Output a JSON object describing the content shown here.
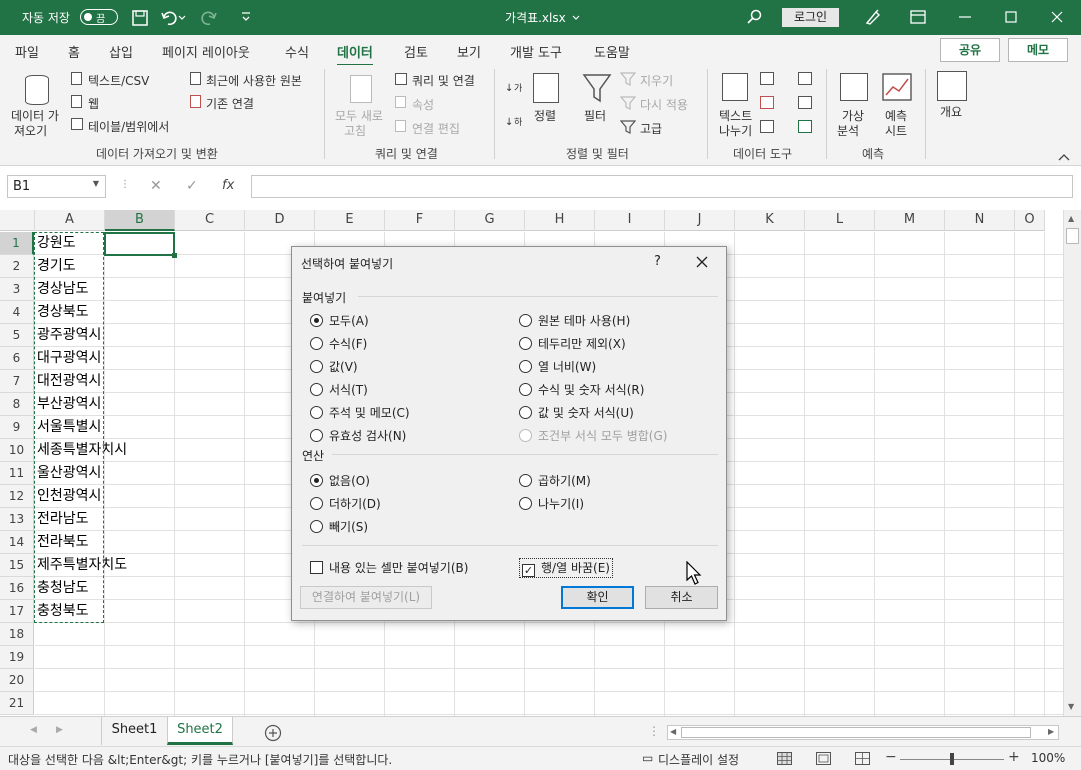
{
  "titlebar": {
    "autosave_label": "자동 저장",
    "autosave_state": "끔",
    "filename": "가격표.xlsx",
    "login": "로그인"
  },
  "menu": {
    "tabs": [
      "파일",
      "홈",
      "삽입",
      "페이지 레이아웃",
      "수식",
      "데이터",
      "검토",
      "보기",
      "개발 도구",
      "도움말"
    ],
    "active": "데이터",
    "share": "공유",
    "memo": "메모"
  },
  "ribbon": {
    "get_data_line1": "데이터 가",
    "get_data_line2": "져오기",
    "text_csv": "텍스트/CSV",
    "web": "웹",
    "table_range": "테이블/범위에서",
    "recent_sources": "최근에 사용한 원본",
    "existing_conn": "기존 연결",
    "refresh_line1": "모두 새로",
    "refresh_line2": "고침",
    "queries_conn": "쿼리 및 연결",
    "properties": "속성",
    "edit_links": "연결 편집",
    "sort": "정렬",
    "filter": "필터",
    "clear": "지우기",
    "reapply": "다시 적용",
    "advanced": "고급",
    "text_to_col_line1": "텍스트",
    "text_to_col_line2": "나누기",
    "whatif_line1": "가상",
    "whatif_line2": "분석",
    "forecast_line1": "예측",
    "forecast_line2": "시트",
    "outline": "개요",
    "group_get": "데이터 가져오기 및 변환",
    "group_queries": "쿼리 및 연결",
    "group_sort": "정렬 및 필터",
    "group_tools": "데이터 도구",
    "group_forecast": "예측"
  },
  "formula": {
    "namebox": "B1",
    "value": ""
  },
  "columns": [
    "A",
    "B",
    "C",
    "D",
    "E",
    "F",
    "G",
    "H",
    "I",
    "J",
    "K",
    "L",
    "M",
    "N",
    "O"
  ],
  "rows": [
    "1",
    "2",
    "3",
    "4",
    "5",
    "6",
    "7",
    "8",
    "9",
    "10",
    "11",
    "12",
    "13",
    "14",
    "15",
    "16",
    "17",
    "18",
    "19",
    "20",
    "21"
  ],
  "cells_a": [
    "강원도",
    "경기도",
    "경상남도",
    "경상북도",
    "광주광역시",
    "대구광역시",
    "대전광역시",
    "부산광역시",
    "서울특별시",
    "세종특별자치시",
    "울산광역시",
    "인천광역시",
    "전라남도",
    "전라북도",
    "제주특별자치도",
    "충청남도",
    "충청북도"
  ],
  "sheets": [
    "Sheet1",
    "Sheet2"
  ],
  "active_sheet": "Sheet2",
  "status": {
    "message": "대상을 선택한 다음 &lt;Enter&gt; 키를 누르거나 [붙여넣기]를 선택합니다.",
    "display_settings": "디스플레이 설정",
    "zoom": "100%",
    "zoom_percent": 100
  },
  "dialog": {
    "title": "선택하여 붙여넣기",
    "help": "?",
    "paste_section": "붙여넣기",
    "paste_left": [
      "모두(A)",
      "수식(F)",
      "값(V)",
      "서식(T)",
      "주석 및 메모(C)",
      "유효성 검사(N)"
    ],
    "paste_right": [
      "원본 테마 사용(H)",
      "테두리만 제외(X)",
      "열 너비(W)",
      "수식 및 숫자 서식(R)",
      "값 및 숫자 서식(U)",
      "조건부 서식 모두 병합(G)"
    ],
    "operation_section": "연산",
    "op_left": [
      "없음(O)",
      "더하기(D)",
      "빼기(S)"
    ],
    "op_right": [
      "곱하기(M)",
      "나누기(I)"
    ],
    "skip_blanks": "내용 있는 셀만 붙여넣기(B)",
    "transpose": "행/열 바꿈(E)",
    "paste_link": "연결하여 붙여넣기(L)",
    "ok": "확인",
    "cancel": "취소"
  },
  "colors": {
    "accent": "#217346",
    "focus": "#0078d7"
  }
}
